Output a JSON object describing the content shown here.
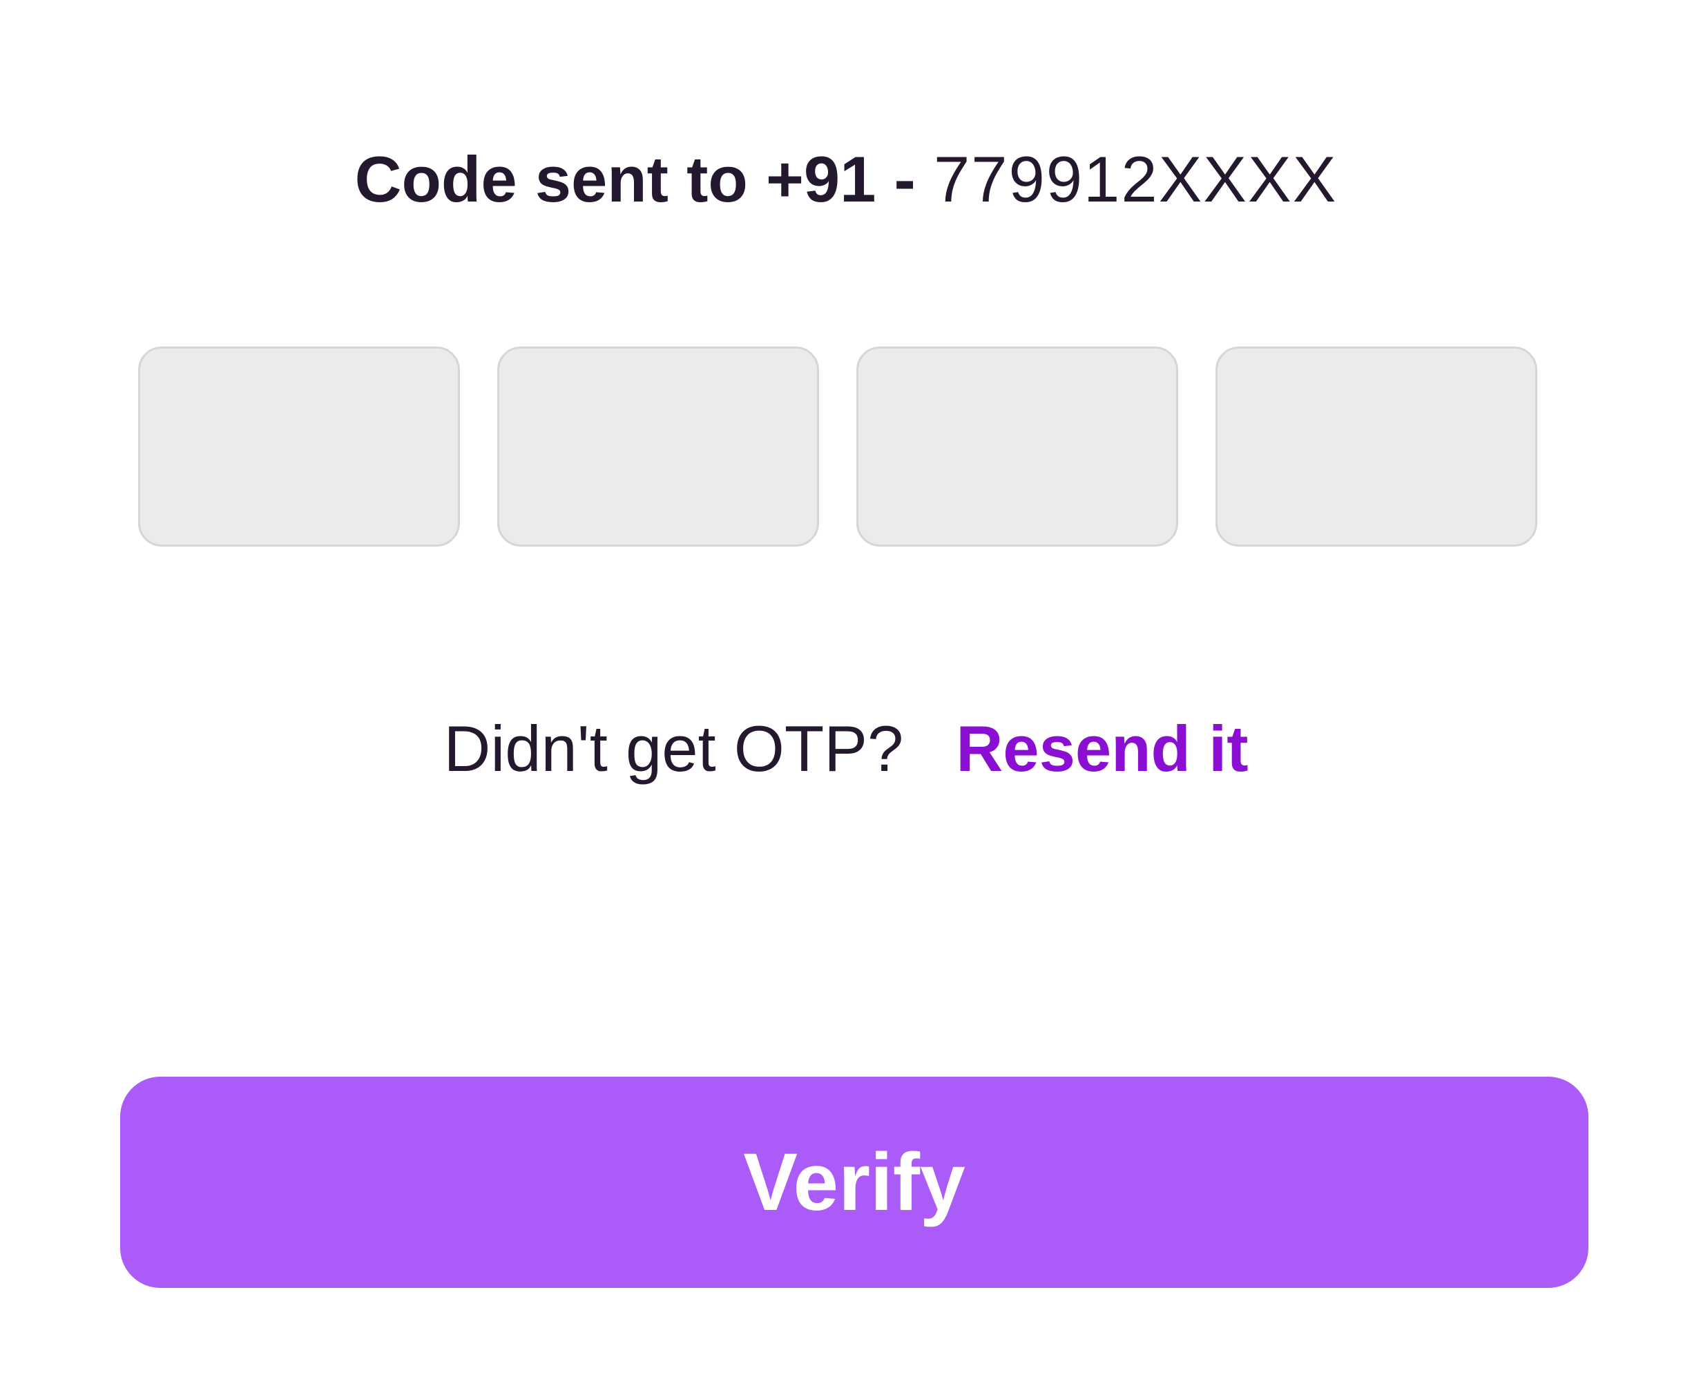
{
  "header": {
    "code_sent_label": "Code sent to +91 -",
    "phone_number": "779912XXXX"
  },
  "otp": {
    "boxes": [
      {
        "value": ""
      },
      {
        "value": ""
      },
      {
        "value": ""
      },
      {
        "value": ""
      }
    ]
  },
  "resend": {
    "prompt": "Didn't get OTP?",
    "link_label": "Resend it"
  },
  "actions": {
    "verify_label": "Verify"
  },
  "colors": {
    "text": "#23182d",
    "accent_link": "#8a0fd3",
    "button_bg": "#aa5bf8",
    "button_text": "#ffffff",
    "input_bg": "#ebebeb",
    "input_border": "#d6d6d6"
  }
}
